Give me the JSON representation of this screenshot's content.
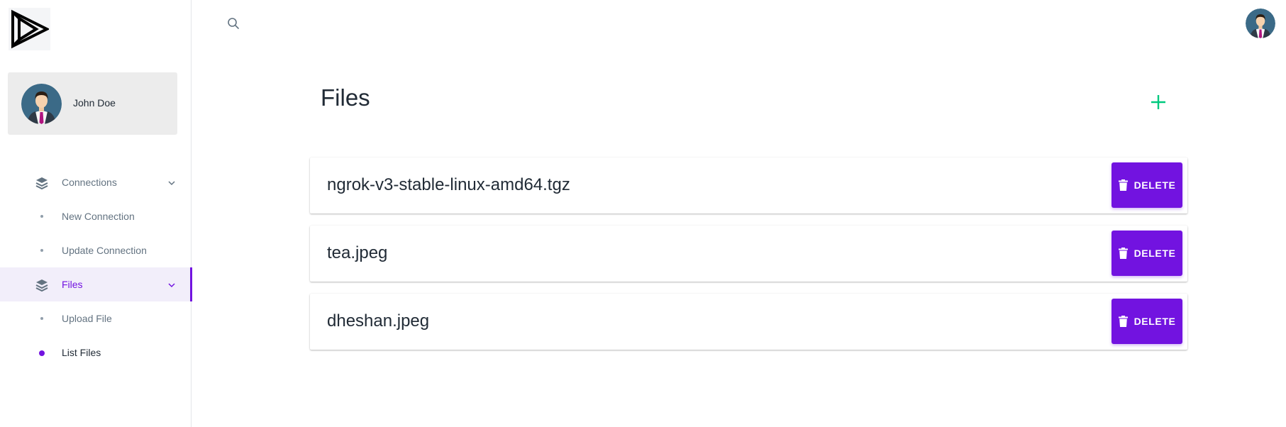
{
  "colors": {
    "accent": "#7213e0",
    "add": "#00c97e",
    "sidebar_active_bg": "#f2eefa"
  },
  "user": {
    "name": "John Doe"
  },
  "nav": {
    "connections": {
      "label": "Connections",
      "icon": "layers-icon"
    },
    "new_connection": {
      "label": "New Connection"
    },
    "update_connection": {
      "label": "Update Connection"
    },
    "files": {
      "label": "Files",
      "icon": "layers-icon"
    },
    "upload_file": {
      "label": "Upload File"
    },
    "list_files": {
      "label": "List Files"
    }
  },
  "page": {
    "title": "Files",
    "add_icon": "plus-icon"
  },
  "files": [
    {
      "name": "ngrok-v3-stable-linux-amd64.tgz",
      "action": "DELETE"
    },
    {
      "name": "tea.jpeg",
      "action": "DELETE"
    },
    {
      "name": "dheshan.jpeg",
      "action": "DELETE"
    }
  ]
}
